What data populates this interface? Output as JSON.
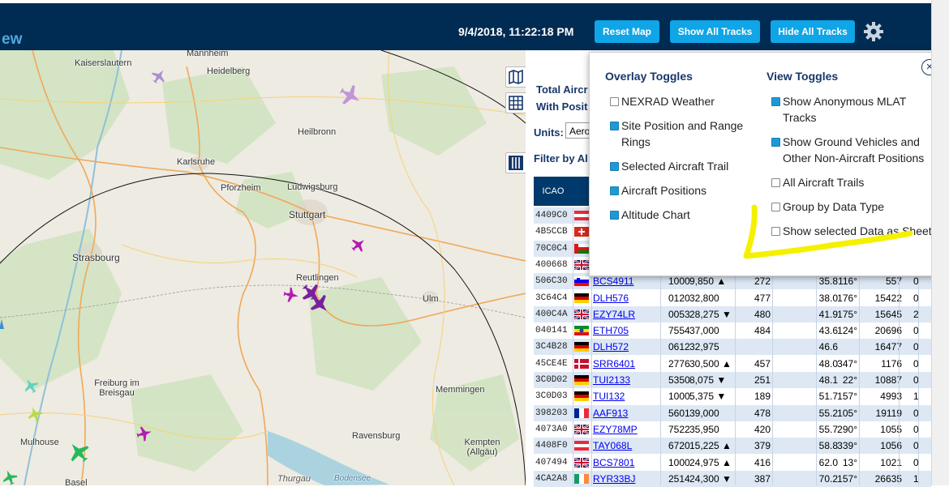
{
  "header": {
    "brand": "ew",
    "datetime": "9/4/2018, 11:22:18 PM",
    "buttons": [
      "Reset Map",
      "Show All Tracks",
      "Hide All Tracks"
    ]
  },
  "map": {
    "cities": [
      "Kaiserslautern",
      "Mannheim",
      "Heidelberg",
      "Heilbronn",
      "Karlsruhe",
      "Pforzheim",
      "Ludwigsburg",
      "Stuttgart",
      "Strasbourg",
      "Reutlingen",
      "Ulm",
      "Freiburg im Breisgau",
      "Memmingen",
      "Mulhouse",
      "Ravensburg",
      "Kempten (Allgäu)",
      "Basel",
      "Thurgau",
      "Bodensee"
    ]
  },
  "panel": {
    "total_aircraft_label": "Total Aircr",
    "with_positions_label": "With Posit",
    "units_label": "Units:",
    "units_value": "Aero",
    "filter_label": "Filter by Al",
    "icao_header": "ICAO"
  },
  "aircraft_rows": [
    {
      "icao": "4409C0",
      "flag": "at",
      "callsign": "",
      "squawk": "",
      "altitude": "",
      "speed": "",
      "distance": "",
      "track": "",
      "messages": "",
      "tail": ""
    },
    {
      "icao": "4B5CCB",
      "flag": "ch",
      "callsign": "",
      "squawk": "",
      "altitude": "",
      "speed": "",
      "distance": "",
      "track": "",
      "messages": "",
      "tail": ""
    },
    {
      "icao": "70C0C4",
      "flag": "om",
      "callsign": "",
      "squawk": "",
      "altitude": "",
      "speed": "",
      "distance": "",
      "track": "",
      "messages": "",
      "tail": ""
    },
    {
      "icao": "400668",
      "flag": "gb",
      "callsign": "",
      "squawk": "",
      "altitude": "",
      "speed": "",
      "distance": "",
      "track": "",
      "messages": "",
      "tail": ""
    },
    {
      "icao": "506C30",
      "flag": "si",
      "callsign": "BCS4911",
      "squawk": "1000",
      "altitude": "9,850 ▲",
      "speed": "272",
      "distance": "35.8",
      "track": "116°",
      "messages": "557",
      "tail": "0"
    },
    {
      "icao": "3C64C4",
      "flag": "de",
      "callsign": "DLH576",
      "squawk": "0120",
      "altitude": "32,800",
      "speed": "477",
      "distance": "38.0",
      "track": "176°",
      "messages": "15422",
      "tail": "0"
    },
    {
      "icao": "400C4A",
      "flag": "gb",
      "callsign": "EZY74LR",
      "squawk": "0053",
      "altitude": "28,275 ▼",
      "speed": "480",
      "distance": "41.9",
      "track": "175°",
      "messages": "15645",
      "tail": "2"
    },
    {
      "icao": "040141",
      "flag": "et",
      "callsign": "ETH705",
      "squawk": "7554",
      "altitude": "37,000",
      "speed": "484",
      "distance": "43.6",
      "track": "124°",
      "messages": "20696",
      "tail": "0"
    },
    {
      "icao": "3C4B28",
      "flag": "de",
      "callsign": "DLH572",
      "squawk": "0612",
      "altitude": "32,975",
      "speed": "",
      "distance": "46.6",
      "track": "",
      "messages": "16477",
      "tail": "0"
    },
    {
      "icao": "45CE4E",
      "flag": "dk",
      "callsign": "SRR6401",
      "squawk": "2776",
      "altitude": "30,500 ▲",
      "speed": "457",
      "distance": "48.0",
      "track": "347°",
      "messages": "1176",
      "tail": "0"
    },
    {
      "icao": "3C0D02",
      "flag": "de",
      "callsign": "TUI2133",
      "squawk": "5350",
      "altitude": "8,075 ▼",
      "speed": "251",
      "distance": "48.1",
      "track": "22°",
      "messages": "10887",
      "tail": "0"
    },
    {
      "icao": "3C0D03",
      "flag": "de",
      "callsign": "TUI132",
      "squawk": "1000",
      "altitude": "5,375 ▼",
      "speed": "189",
      "distance": "51.7",
      "track": "157°",
      "messages": "4993",
      "tail": "1"
    },
    {
      "icao": "398203",
      "flag": "fr",
      "callsign": "AAF913",
      "squawk": "5601",
      "altitude": "39,000",
      "speed": "478",
      "distance": "55.2",
      "track": "105°",
      "messages": "19119",
      "tail": "0"
    },
    {
      "icao": "4073A0",
      "flag": "gb",
      "callsign": "EZY78MP",
      "squawk": "7522",
      "altitude": "35,950",
      "speed": "420",
      "distance": "55.7",
      "track": "290°",
      "messages": "1055",
      "tail": "0"
    },
    {
      "icao": "4408F0",
      "flag": "at",
      "callsign": "TAY068L",
      "squawk": "6720",
      "altitude": "15,225 ▲",
      "speed": "379",
      "distance": "58.8",
      "track": "339°",
      "messages": "1056",
      "tail": "0"
    },
    {
      "icao": "407494",
      "flag": "gb",
      "callsign": "BCS7801",
      "squawk": "1000",
      "altitude": "24,975 ▲",
      "speed": "416",
      "distance": "62.0",
      "track": "13°",
      "messages": "1021",
      "tail": "0"
    },
    {
      "icao": "4CA2A8",
      "flag": "ie",
      "callsign": "RYR33BJ",
      "squawk": "2514",
      "altitude": "24,300 ▼",
      "speed": "387",
      "distance": "70.2",
      "track": "157°",
      "messages": "26635",
      "tail": "1"
    }
  ],
  "settings_overlay": {
    "overlay_title": "Overlay Toggles",
    "view_title": "View Toggles",
    "overlay_items": [
      {
        "label": "NEXRAD Weather",
        "checked": false
      },
      {
        "label": "Site Position and Range Rings",
        "checked": true
      },
      {
        "label": "Selected Aircraft Trail",
        "checked": true
      },
      {
        "label": "Aircraft Positions",
        "checked": true
      },
      {
        "label": "Altitude Chart",
        "checked": true
      }
    ],
    "view_items": [
      {
        "label": "Show Anonymous MLAT Tracks",
        "checked": true
      },
      {
        "label": "Show Ground Vehicles and Other Non-Aircraft Positions",
        "checked": true
      },
      {
        "label": "All Aircraft Trails",
        "checked": false
      },
      {
        "label": "Group by Data Type",
        "checked": false
      },
      {
        "label": "Show selected Data as Sheet",
        "checked": false
      }
    ]
  },
  "colors": {
    "header_bg": "#002b52",
    "button": "#0fa5e6",
    "accent": "#1d9ad6",
    "highlight": "#f5f000"
  }
}
